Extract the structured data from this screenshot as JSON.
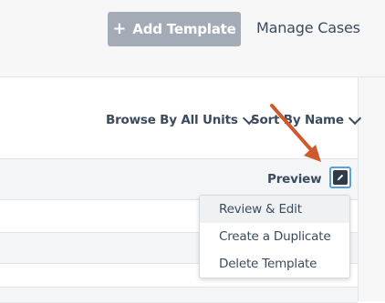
{
  "header": {
    "add_template_label": "Add Template",
    "plus_icon": "+",
    "manage_cases_label": "Manage Cases"
  },
  "filters": {
    "browse_units_label": "Browse By All Units",
    "sort_label": "Sort By Name"
  },
  "template_row": {
    "preview_label": "Preview",
    "edit_icon": "pencil-icon"
  },
  "dropdown_menu": {
    "items": [
      {
        "label": "Review & Edit",
        "highlighted": true
      },
      {
        "label": "Create a Duplicate",
        "highlighted": false
      },
      {
        "label": "Delete Template",
        "highlighted": false
      }
    ]
  },
  "colors": {
    "accent_border": "#5a9fe0",
    "button_gray": "#a2abb6",
    "text_dark": "#3c4a5e",
    "annotation_arrow": "#cf5a2e"
  }
}
